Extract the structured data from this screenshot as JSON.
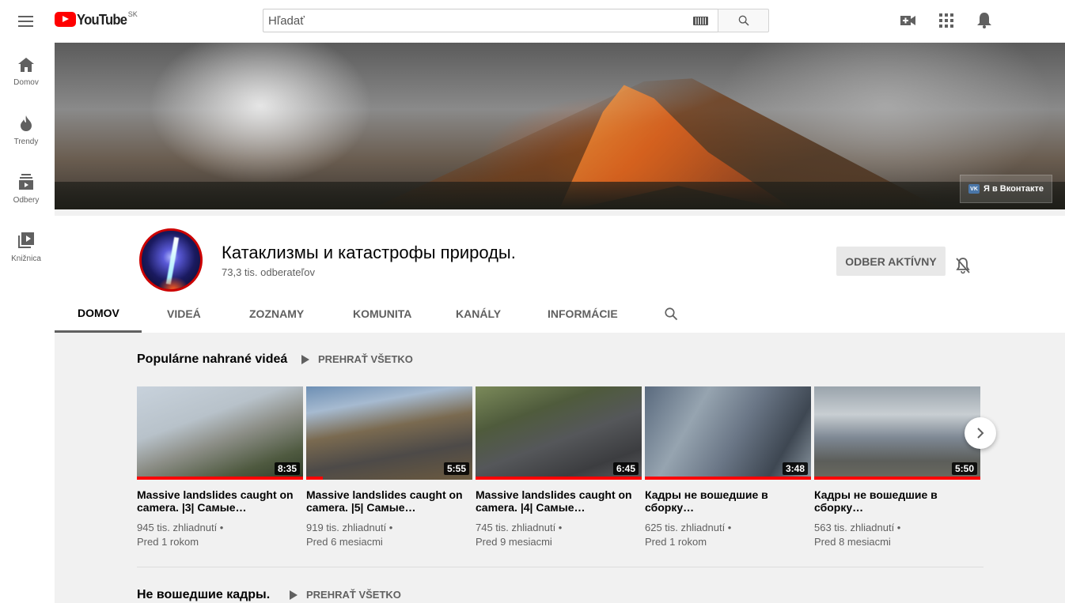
{
  "masthead": {
    "logo_text": "YouTube",
    "country_code": "SK",
    "search_placeholder": "Hľadať"
  },
  "guide": {
    "items": [
      {
        "label": "Domov",
        "icon": "home-icon"
      },
      {
        "label": "Trendy",
        "icon": "fire-icon"
      },
      {
        "label": "Odbery",
        "icon": "subscriptions-icon"
      },
      {
        "label": "Knižnica",
        "icon": "library-icon"
      }
    ]
  },
  "banner": {
    "link_text": "Я в Вконтакте",
    "vk_badge": "VK"
  },
  "channel": {
    "title": "Катаклизмы и катастрофы природы.",
    "subscribers": "73,3 tis. odberateľov",
    "subscribe_label": "ODBER AKTÍVNY"
  },
  "tabs": [
    {
      "label": "DOMOV",
      "active": true
    },
    {
      "label": "VIDEÁ",
      "active": false
    },
    {
      "label": "ZOZNAMY",
      "active": false
    },
    {
      "label": "KOMUNITA",
      "active": false
    },
    {
      "label": "KANÁLY",
      "active": false
    },
    {
      "label": "INFORMÁCIE",
      "active": false
    }
  ],
  "shelf1": {
    "title": "Populárne nahrané videá",
    "play_all": "PREHRAŤ VŠETKO",
    "videos": [
      {
        "title": "Massive landslides caught on camera. |3| Самые…",
        "duration": "8:35",
        "views": "945 tis. zhliadnutí •",
        "age": "Pred 1 rokom",
        "watched": 1.0
      },
      {
        "title": "Massive landslides caught on camera. |5| Самые…",
        "duration": "5:55",
        "views": "919 tis. zhliadnutí •",
        "age": "Pred 6 mesiacmi",
        "watched": 0.1
      },
      {
        "title": "Massive landslides caught on camera. |4| Самые…",
        "duration": "6:45",
        "views": "745 tis. zhliadnutí •",
        "age": "Pred 9 mesiacmi",
        "watched": 1.0
      },
      {
        "title": "Кадры не вошедшие в сборку…",
        "duration": "3:48",
        "views": "625 tis. zhliadnutí •",
        "age": "Pred 1 rokom",
        "watched": 1.0
      },
      {
        "title": "Кадры не вошедшие в сборку…",
        "duration": "5:50",
        "views": "563 tis. zhliadnutí •",
        "age": "Pred 8 mesiacmi",
        "watched": 1.0
      }
    ]
  },
  "shelf2": {
    "title": "Не вошедшие кадры.",
    "play_all": "PREHRAŤ VŠETKO"
  }
}
